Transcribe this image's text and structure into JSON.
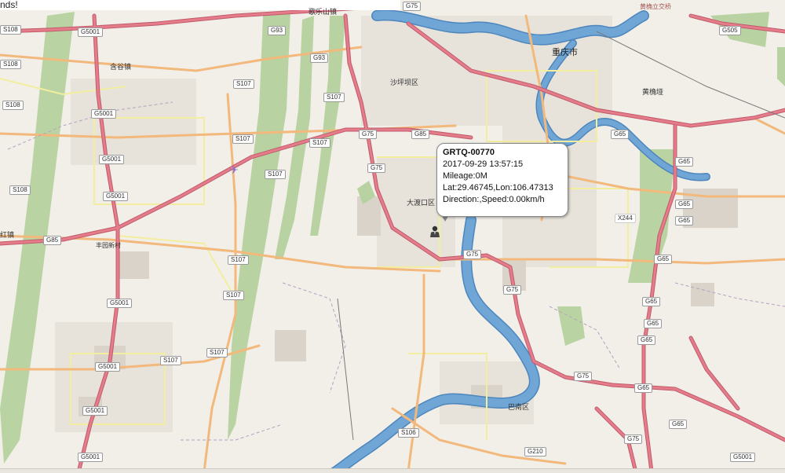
{
  "banner": {
    "text": "nds!"
  },
  "popup": {
    "device_id": "GRTQ-00770",
    "timestamp": "2017-09-29 13:57:15",
    "mileage": "Mileage:0M",
    "coords": "Lat:29.46745,Lon:106.47313",
    "direction_speed": "Direction:,Speed:0.00km/h"
  },
  "places": {
    "chongqing": "重庆市",
    "shapingba": "沙坪坝区",
    "dadukou": "大渡口区",
    "banan": "巴南区",
    "huangjueya": "黄桷垭",
    "taijiazhen": "含谷镇",
    "gegeguo": "歌乐山镇",
    "hongjiang": "红镇",
    "fengyuanxincun": "丰园新村",
    "huangjueli": "黄桷立交桥"
  },
  "road_shields": {
    "g75": "G75",
    "g85": "G85",
    "g93": "G93",
    "g65": "G65",
    "g5001": "G5001",
    "g505": "G505",
    "g210": "G210",
    "s107": "S107",
    "s108": "S108",
    "s106": "S106",
    "x244": "X244"
  },
  "colors": {
    "land": "#f2efe9",
    "river": "#6fa6d6",
    "river_edge": "#4d86bd",
    "green": "#b5d29e",
    "motorway": "#e57c8a",
    "trunk": "#f4b37a",
    "primary": "#fcd6a4",
    "secondary": "#f6f0a5"
  },
  "icons": {
    "marker": "vehicle-person-icon",
    "airport": "airport-icon"
  }
}
